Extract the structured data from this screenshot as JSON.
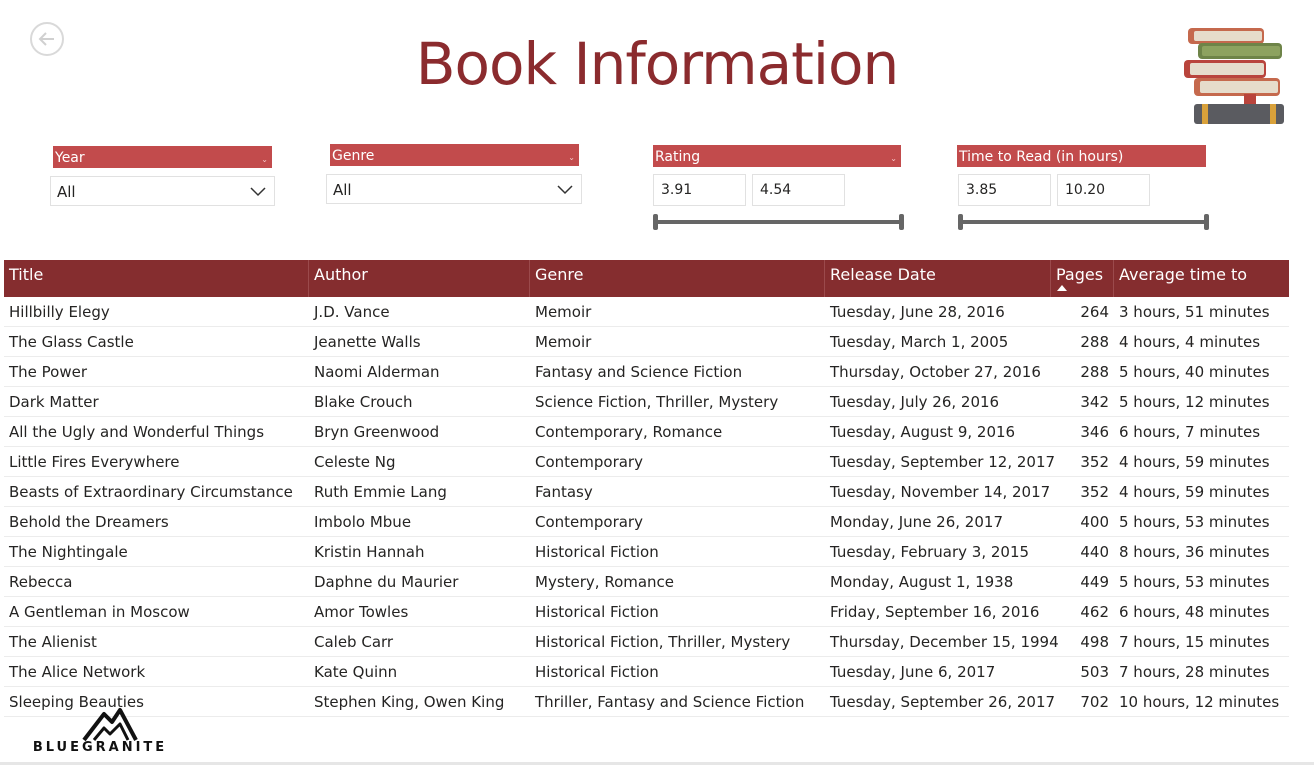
{
  "page": {
    "title": "Book Information"
  },
  "filters": {
    "year": {
      "label": "Year",
      "value": "All"
    },
    "genre": {
      "label": "Genre",
      "value": "All"
    },
    "rating": {
      "label": "Rating",
      "min": "3.91",
      "max": "4.54"
    },
    "time": {
      "label": "Time to Read (in hours)",
      "min": "3.85",
      "max": "10.20"
    }
  },
  "table": {
    "columns": [
      "Title",
      "Author",
      "Genre",
      "Release Date",
      "Pages",
      "Average time to Read"
    ],
    "rows": [
      [
        "Hillbilly Elegy",
        "J.D. Vance",
        "Memoir",
        "Tuesday, June 28, 2016",
        "264",
        "3 hours, 51 minutes"
      ],
      [
        "The Glass Castle",
        "Jeanette Walls",
        "Memoir",
        "Tuesday, March 1, 2005",
        "288",
        "4 hours, 4 minutes"
      ],
      [
        "The Power",
        "Naomi Alderman",
        "Fantasy and Science Fiction",
        "Thursday, October 27, 2016",
        "288",
        "5 hours, 40 minutes"
      ],
      [
        "Dark Matter",
        "Blake Crouch",
        "Science Fiction, Thriller, Mystery",
        "Tuesday, July 26, 2016",
        "342",
        "5 hours, 12 minutes"
      ],
      [
        "All the Ugly and Wonderful Things",
        "Bryn Greenwood",
        "Contemporary, Romance",
        "Tuesday, August 9, 2016",
        "346",
        "6 hours, 7 minutes"
      ],
      [
        "Little Fires Everywhere",
        "Celeste Ng",
        "Contemporary",
        "Tuesday, September 12, 2017",
        "352",
        "4 hours, 59 minutes"
      ],
      [
        "Beasts of Extraordinary Circumstance",
        "Ruth Emmie Lang",
        "Fantasy",
        "Tuesday, November 14, 2017",
        "352",
        "4 hours, 59 minutes"
      ],
      [
        "Behold the Dreamers",
        "Imbolo Mbue",
        "Contemporary",
        "Monday, June 26, 2017",
        "400",
        "5 hours, 53 minutes"
      ],
      [
        "The Nightingale",
        "Kristin Hannah",
        "Historical Fiction",
        "Tuesday, February 3, 2015",
        "440",
        "8 hours, 36 minutes"
      ],
      [
        "Rebecca",
        "Daphne du Maurier",
        "Mystery, Romance",
        "Monday, August 1, 1938",
        "449",
        "5 hours, 53 minutes"
      ],
      [
        "A Gentleman in Moscow",
        "Amor Towles",
        "Historical Fiction",
        "Friday, September 16, 2016",
        "462",
        "6 hours, 48 minutes"
      ],
      [
        "The Alienist",
        "Caleb Carr",
        "Historical Fiction, Thriller, Mystery",
        "Thursday, December 15, 1994",
        "498",
        "7 hours, 15 minutes"
      ],
      [
        "The Alice Network",
        "Kate Quinn",
        "Historical Fiction",
        "Tuesday, June 6, 2017",
        "503",
        "7 hours, 28 minutes"
      ],
      [
        "Sleeping Beauties",
        "Stephen King, Owen King",
        "Thriller, Fantasy and Science Fiction",
        "Tuesday, September 26, 2017",
        "702",
        "10 hours, 12 minutes"
      ]
    ]
  },
  "brand": {
    "name": "BLUEGRANITE"
  },
  "icons": {
    "back": "back-arrow-icon",
    "books": "book-stack-icon",
    "dropdown": "chevron-down-icon",
    "logo": "mountain-logo-icon"
  },
  "colors": {
    "title": "#8b2b2e",
    "slicer_header": "#c24b4c",
    "table_header": "#852d2f"
  }
}
